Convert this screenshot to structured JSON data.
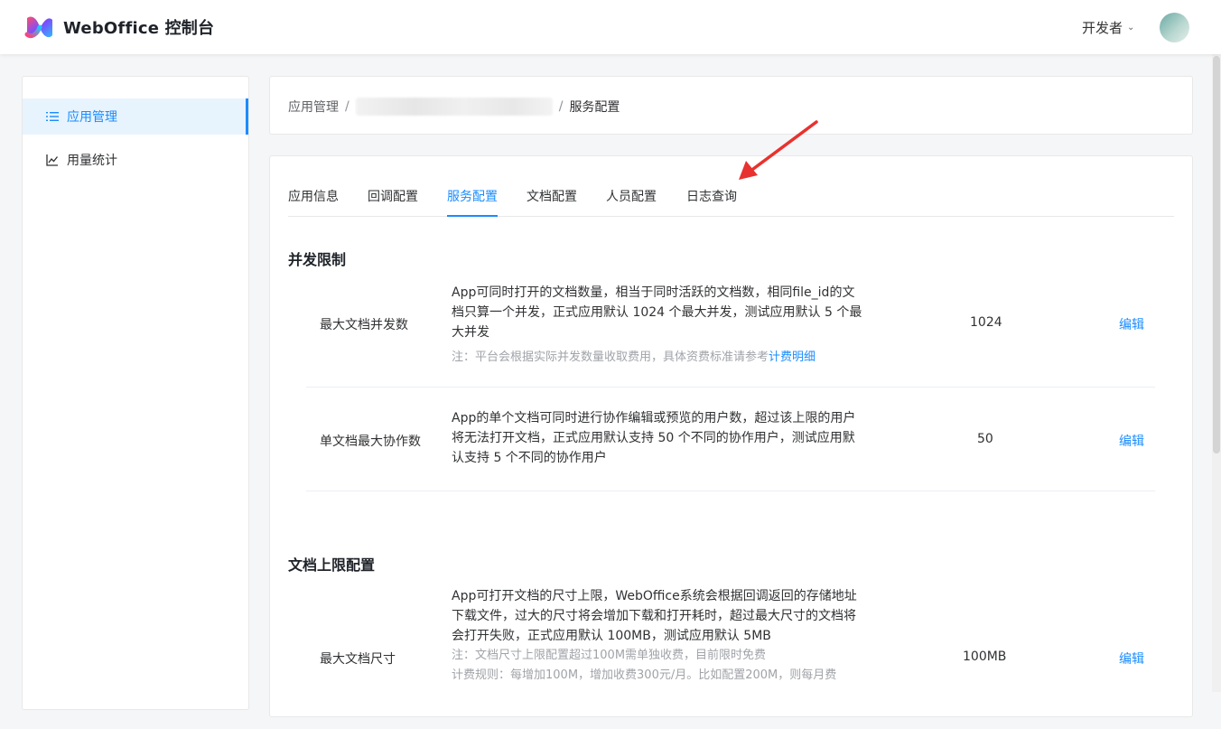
{
  "header": {
    "brand": "WebOffice 控制台",
    "user_menu": "开发者"
  },
  "sidebar": {
    "items": [
      {
        "label": "应用管理",
        "icon": "list-icon",
        "active": true
      },
      {
        "label": "用量统计",
        "icon": "line-chart-icon",
        "active": false
      }
    ]
  },
  "breadcrumb": {
    "root": "应用管理",
    "separator": "/",
    "current": "服务配置"
  },
  "tabs": [
    {
      "label": "应用信息",
      "active": false
    },
    {
      "label": "回调配置",
      "active": false
    },
    {
      "label": "服务配置",
      "active": true
    },
    {
      "label": "文档配置",
      "active": false
    },
    {
      "label": "人员配置",
      "active": false
    },
    {
      "label": "日志查询",
      "active": false
    }
  ],
  "sections": [
    {
      "title": "并发限制",
      "rows": [
        {
          "name": "最大文档并发数",
          "desc_lines": [
            "App可同时打开的文档数量，相当于同时活跃的文档数，相同file_id的文",
            "档只算一个并发，正式应用默认 1024 个最大并发，测试应用默认 5 个最",
            "大并发"
          ],
          "note": "注：平台会根据实际并发数量收取费用，具体资费标准请参考",
          "note_link": "计费明细",
          "value": "1024",
          "action": "编辑"
        },
        {
          "name": "单文档最大协作数",
          "desc_lines": [
            "App的单个文档可同时进行协作编辑或预览的用户数，超过该上限的用户",
            "将无法打开文档，正式应用默认支持 50 个不同的协作用户，测试应用默",
            "认支持 5 个不同的协作用户"
          ],
          "value": "50",
          "action": "编辑"
        }
      ]
    },
    {
      "title": "文档上限配置",
      "rows": [
        {
          "name": "最大文档尺寸",
          "desc_lines": [
            "App可打开文档的尺寸上限，WebOffice系统会根据回调返回的存储地址",
            "下载文件，过大的尺寸将会增加下载和打开耗时，超过最大尺寸的文档将",
            "会打开失败，正式应用默认 100MB，测试应用默认 5MB"
          ],
          "note_lines": [
            "注：文档尺寸上限配置超过100M需单独收费，目前限时免费",
            "计费规则：每增加100M，增加收费300元/月。比如配置200M，则每月费"
          ],
          "value": "100MB",
          "action": "编辑"
        }
      ]
    }
  ],
  "colors": {
    "accent": "#1a8cff",
    "annotation_arrow": "#e8322f"
  }
}
